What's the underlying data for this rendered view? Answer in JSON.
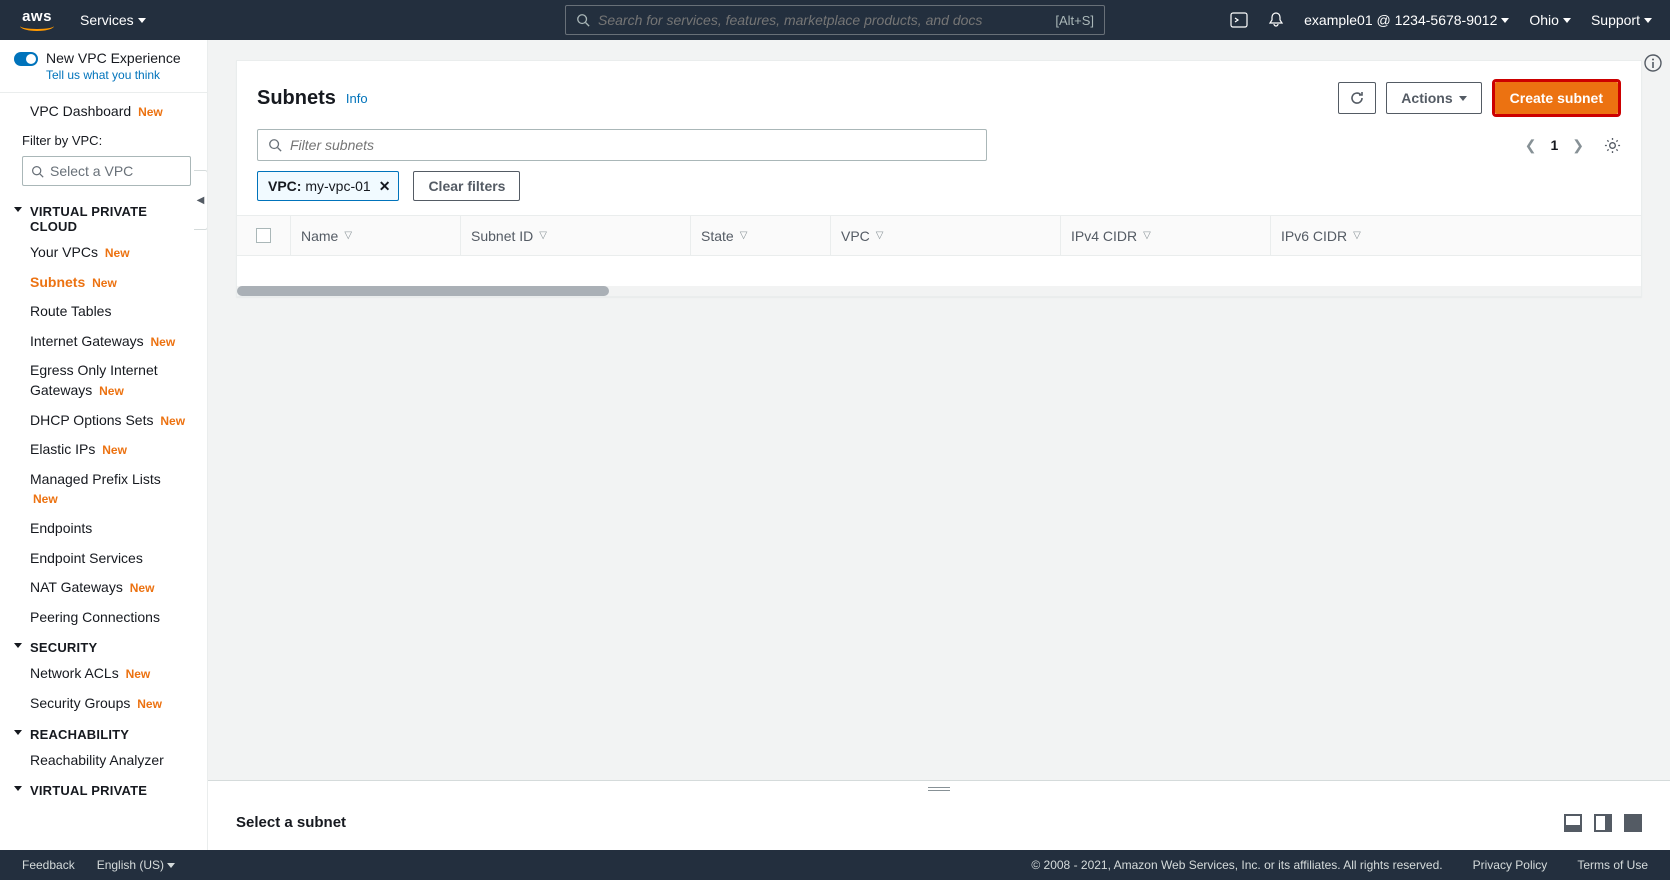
{
  "topnav": {
    "services": "Services",
    "search_placeholder": "Search for services, features, marketplace products, and docs",
    "search_shortcut": "[Alt+S]",
    "account": "example01 @ 1234-5678-9012",
    "region": "Ohio",
    "support": "Support"
  },
  "sidebar": {
    "experience_title": "New VPC Experience",
    "experience_link": "Tell us what you think",
    "dashboard": "VPC Dashboard",
    "dashboard_new": "New",
    "filter_label": "Filter by VPC:",
    "vpc_select_placeholder": "Select a VPC",
    "sections": [
      {
        "title": "VIRTUAL PRIVATE CLOUD",
        "items": [
          {
            "label": "Your VPCs",
            "new": true,
            "active": false
          },
          {
            "label": "Subnets",
            "new": true,
            "active": true
          },
          {
            "label": "Route Tables",
            "new": false,
            "active": false
          },
          {
            "label": "Internet Gateways",
            "new": true,
            "active": false
          },
          {
            "label": "Egress Only Internet Gateways",
            "new": true,
            "active": false
          },
          {
            "label": "DHCP Options Sets",
            "new": true,
            "active": false
          },
          {
            "label": "Elastic IPs",
            "new": true,
            "active": false
          },
          {
            "label": "Managed Prefix Lists",
            "new": true,
            "active": false
          },
          {
            "label": "Endpoints",
            "new": false,
            "active": false
          },
          {
            "label": "Endpoint Services",
            "new": false,
            "active": false
          },
          {
            "label": "NAT Gateways",
            "new": true,
            "active": false
          },
          {
            "label": "Peering Connections",
            "new": false,
            "active": false
          }
        ]
      },
      {
        "title": "SECURITY",
        "items": [
          {
            "label": "Network ACLs",
            "new": true,
            "active": false
          },
          {
            "label": "Security Groups",
            "new": true,
            "active": false
          }
        ]
      },
      {
        "title": "REACHABILITY",
        "items": [
          {
            "label": "Reachability Analyzer",
            "new": false,
            "active": false
          }
        ]
      },
      {
        "title": "VIRTUAL PRIVATE",
        "items": []
      }
    ]
  },
  "panel": {
    "title": "Subnets",
    "info": "Info",
    "actions_label": "Actions",
    "create_label": "Create subnet",
    "filter_placeholder": "Filter subnets",
    "page": "1",
    "chip_key": "VPC:",
    "chip_value": "my-vpc-01",
    "clear_filters": "Clear filters",
    "columns": [
      "Name",
      "Subnet ID",
      "State",
      "VPC",
      "IPv4 CIDR",
      "IPv6 CIDR"
    ]
  },
  "detail": {
    "title": "Select a subnet"
  },
  "footer": {
    "feedback": "Feedback",
    "language": "English (US)",
    "copyright": "© 2008 - 2021, Amazon Web Services, Inc. or its affiliates. All rights reserved.",
    "privacy": "Privacy Policy",
    "terms": "Terms of Use"
  }
}
